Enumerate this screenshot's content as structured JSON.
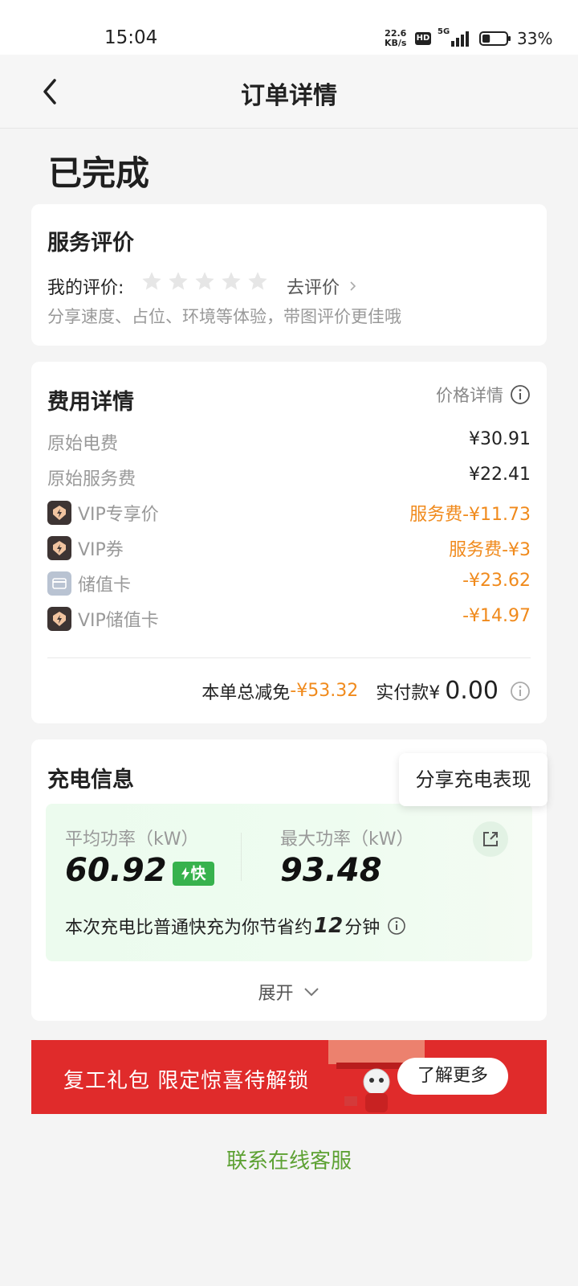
{
  "status_bar": {
    "time": "15:04",
    "speed_top": "22.6",
    "speed_unit": "KB/s",
    "hd": "HD",
    "network": "5G",
    "battery": "33%",
    "battery_level": 0.33
  },
  "header": {
    "title": "订单详情",
    "back_icon": "chevron-left-icon"
  },
  "order_status": "已完成",
  "rating": {
    "title": "服务评价",
    "my_rating_label": "我的评价:",
    "stars_total": 5,
    "stars_filled": 0,
    "go_rate": "去评价",
    "hint": "分享速度、占位、环境等体验，带图评价更佳哦"
  },
  "fees": {
    "title": "费用详情",
    "price_detail": "价格详情",
    "rows": [
      {
        "label": "原始电费",
        "value": "¥30.91",
        "icon": "",
        "highlight": false
      },
      {
        "label": "原始服务费",
        "value": "¥22.41",
        "icon": "",
        "highlight": false
      },
      {
        "label": "VIP专享价",
        "value": "服务费-¥11.73",
        "icon": "vip-badge-icon",
        "highlight": true
      },
      {
        "label": "VIP券",
        "value": "服务费-¥3",
        "icon": "vip-badge-icon",
        "highlight": true
      },
      {
        "label": "储值卡",
        "value": "-¥23.62",
        "icon": "stored-card-icon",
        "highlight": true
      },
      {
        "label": "VIP储值卡",
        "value": "-¥14.97",
        "icon": "vip-badge-icon",
        "highlight": true
      }
    ],
    "total_discount_label": "本单总减免",
    "total_discount_value": "-¥53.32",
    "paid_label": "实付款¥",
    "paid_value": "0.00"
  },
  "charging": {
    "title": "充电信息",
    "share_tip": "分享充电表现",
    "avg_power_label": "平均功率（kW）",
    "avg_power_value": "60.92",
    "fast_tag": "快",
    "max_power_label": "最大功率（kW）",
    "max_power_value": "93.48",
    "save_prefix": "本次充电比普通快充为你节省约",
    "save_minutes": "12",
    "save_suffix": "分钟",
    "expand": "展开"
  },
  "banner": {
    "text": "复工礼包 限定惊喜待解锁",
    "button": "了解更多"
  },
  "contact": "联系在线客服",
  "colors": {
    "accent_orange": "#f08a1c",
    "accent_green": "#37b24d",
    "banner_red": "#e02b2b",
    "contact_green": "#5da133"
  }
}
